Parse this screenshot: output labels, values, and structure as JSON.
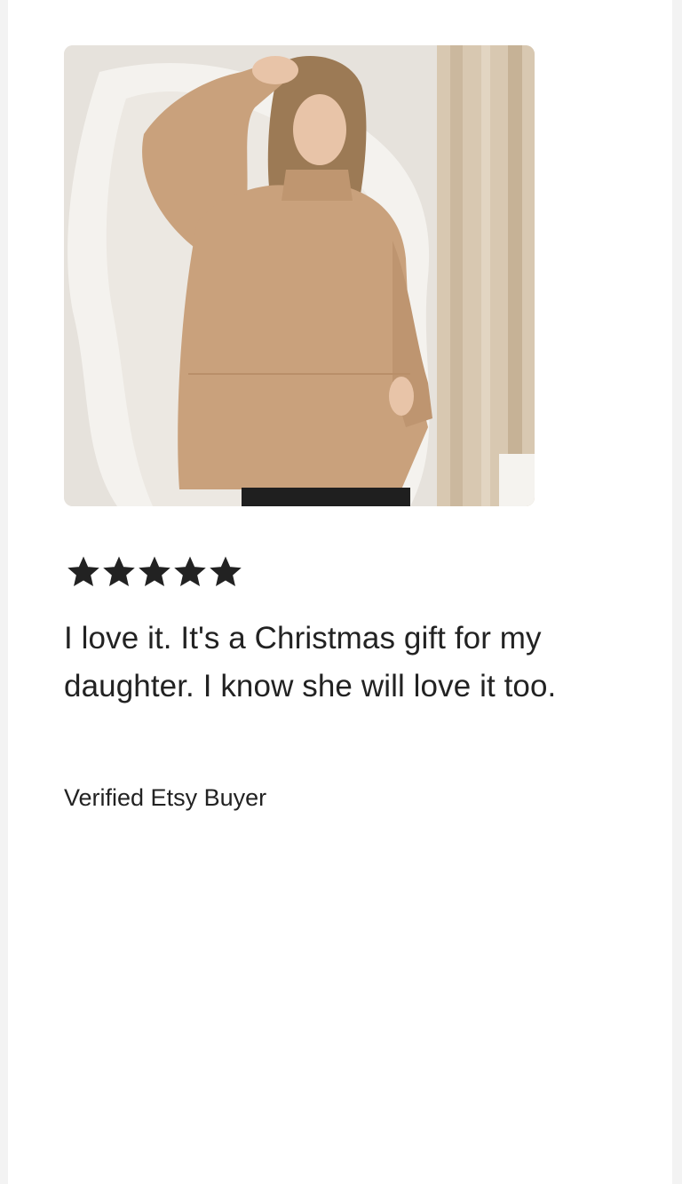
{
  "review": {
    "rating": 5,
    "rating_max": 5,
    "text": "I love it. It's a Christmas gift for my daughter. I know she will love it too.",
    "author": "Verified Etsy Buyer"
  },
  "photo": {
    "subject": "woman-in-camel-turtleneck-sweater"
  },
  "colors": {
    "text": "#222222",
    "star": "#222222",
    "sweater": "#c9a17c",
    "background": "#ffffff"
  },
  "icons": {
    "star": "star-icon"
  }
}
